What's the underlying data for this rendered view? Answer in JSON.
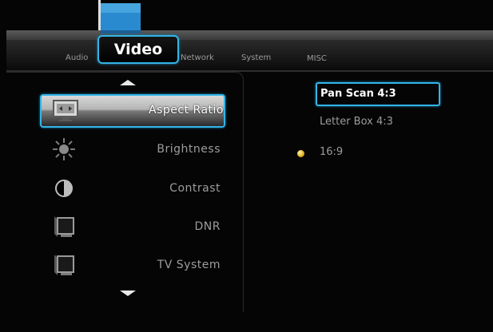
{
  "tabs": [
    {
      "label": "Audio",
      "active": false
    },
    {
      "label": "Video",
      "active": true
    },
    {
      "label": "Network",
      "active": false
    },
    {
      "label": "System",
      "active": false
    },
    {
      "label": "MISC",
      "active": false
    }
  ],
  "menu": {
    "items": [
      {
        "label": "Aspect Ratio",
        "icon": "aspect-ratio-icon",
        "selected": true
      },
      {
        "label": "Brightness",
        "icon": "sun-icon",
        "selected": false
      },
      {
        "label": "Contrast",
        "icon": "contrast-icon",
        "selected": false
      },
      {
        "label": "DNR",
        "icon": "monitor-icon",
        "selected": false
      },
      {
        "label": "TV System",
        "icon": "monitor-icon",
        "selected": false
      }
    ]
  },
  "options": {
    "items": [
      {
        "label": "Pan Scan 4:3",
        "highlighted": true,
        "current": false
      },
      {
        "label": "Letter Box 4:3",
        "highlighted": false,
        "current": false
      },
      {
        "label": "16:9",
        "highlighted": false,
        "current": true
      }
    ]
  },
  "colors": {
    "accent": "#33b5e6",
    "background": "#050505",
    "current_dot": "#e0b020"
  }
}
